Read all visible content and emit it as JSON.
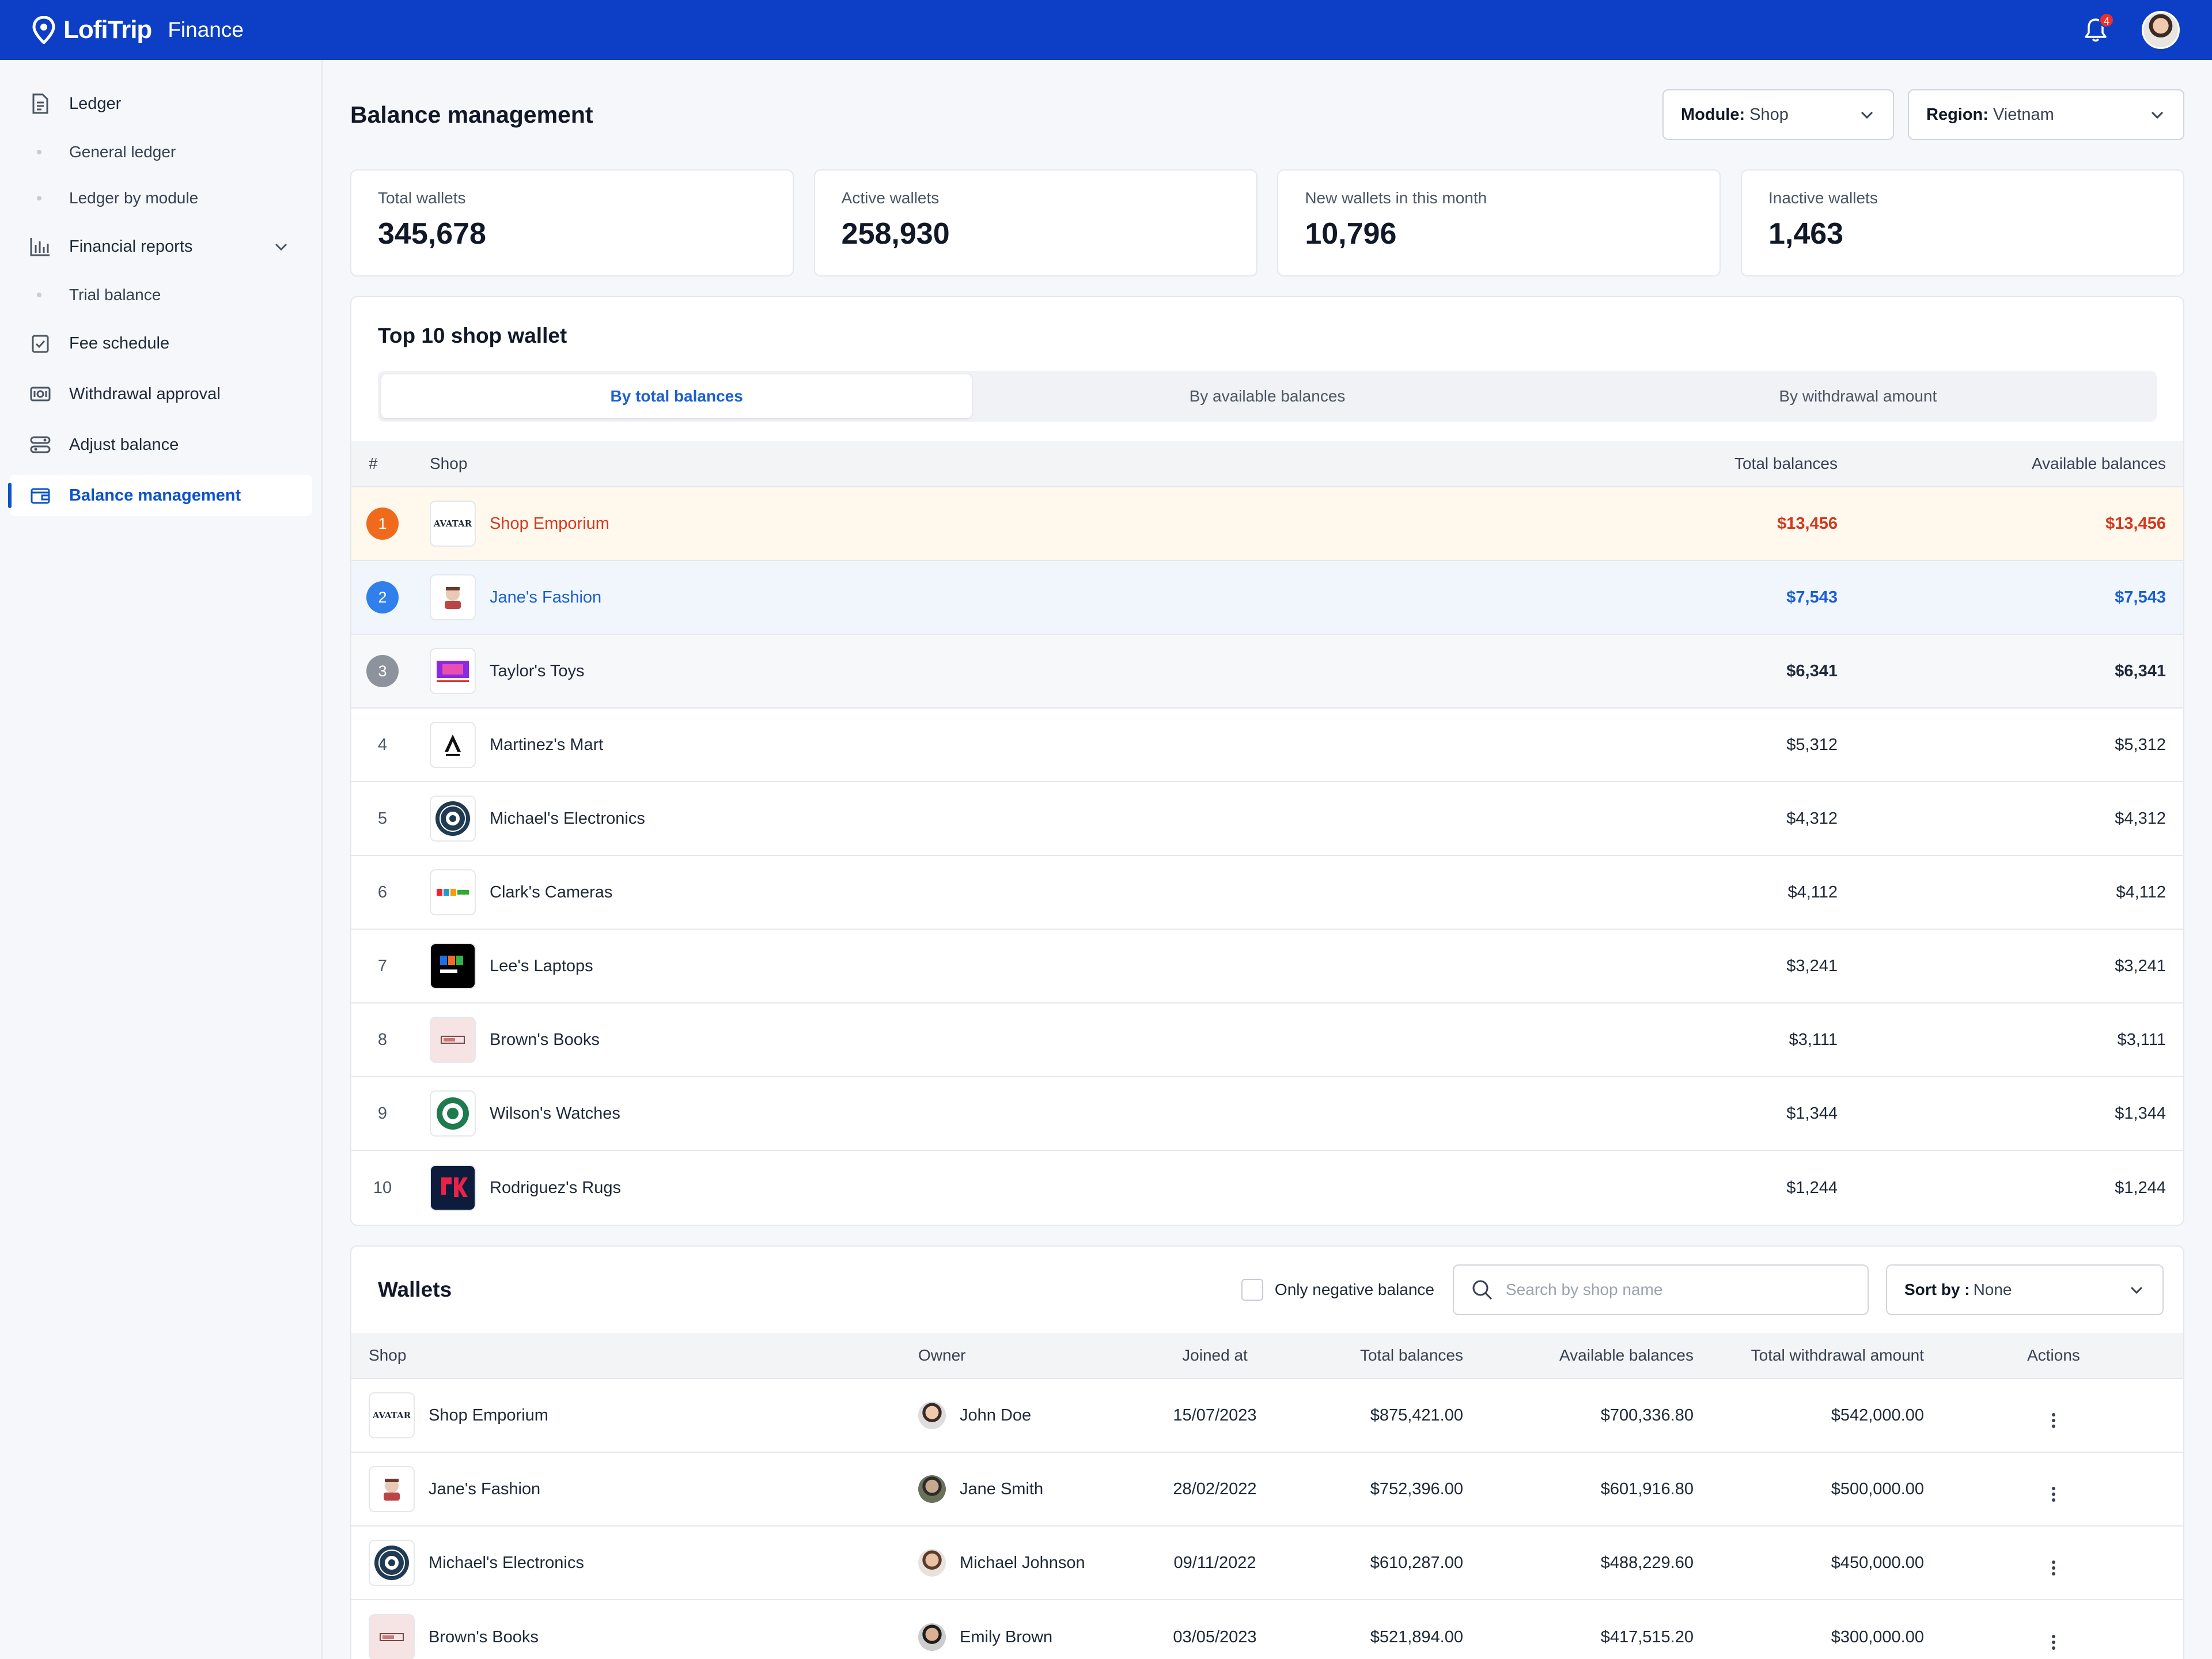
{
  "app": {
    "name": "LofiTrip",
    "section": "Finance",
    "notification_count": "4"
  },
  "sidebar": {
    "ledger": "Ledger",
    "general_ledger": "General ledger",
    "ledger_by_module": "Ledger by module",
    "financial_reports": "Financial reports",
    "trial_balance": "Trial balance",
    "fee_schedule": "Fee schedule",
    "withdrawal_approval": "Withdrawal approval",
    "adjust_balance": "Adjust balance",
    "balance_management": "Balance management"
  },
  "page": {
    "title": "Balance management",
    "module_label": "Module:",
    "module_value": "Shop",
    "region_label": "Region:",
    "region_value": "Vietnam"
  },
  "stats": [
    {
      "label": "Total wallets",
      "value": "345,678"
    },
    {
      "label": "Active wallets",
      "value": "258,930"
    },
    {
      "label": "New wallets in this month",
      "value": "10,796"
    },
    {
      "label": "Inactive wallets",
      "value": "1,463"
    }
  ],
  "top10": {
    "title": "Top 10 shop wallet",
    "tabs": [
      "By total balances",
      "By available balances",
      "By withdrawal amount"
    ],
    "columns": {
      "rank": "#",
      "shop": "Shop",
      "total": "Total balances",
      "available": "Available balances"
    },
    "rows": [
      {
        "rank": "1",
        "shop": "Shop Emporium",
        "logo": "AVATAR",
        "total": "$13,456",
        "available": "$13,456"
      },
      {
        "rank": "2",
        "shop": "Jane's Fashion",
        "logo": "",
        "total": "$7,543",
        "available": "$7,543"
      },
      {
        "rank": "3",
        "shop": "Taylor's Toys",
        "logo": "",
        "total": "$6,341",
        "available": "$6,341"
      },
      {
        "rank": "4",
        "shop": "Martinez's Mart",
        "logo": "",
        "total": "$5,312",
        "available": "$5,312"
      },
      {
        "rank": "5",
        "shop": "Michael's Electronics",
        "logo": "",
        "total": "$4,312",
        "available": "$4,312"
      },
      {
        "rank": "6",
        "shop": "Clark's Cameras",
        "logo": "",
        "total": "$4,112",
        "available": "$4,112"
      },
      {
        "rank": "7",
        "shop": "Lee's Laptops",
        "logo": "",
        "total": "$3,241",
        "available": "$3,241"
      },
      {
        "rank": "8",
        "shop": "Brown's Books",
        "logo": "",
        "total": "$3,111",
        "available": "$3,111"
      },
      {
        "rank": "9",
        "shop": "Wilson's Watches",
        "logo": "",
        "total": "$1,344",
        "available": "$1,344"
      },
      {
        "rank": "10",
        "shop": "Rodriguez's Rugs",
        "logo": "",
        "total": "$1,244",
        "available": "$1,244"
      }
    ]
  },
  "wallets": {
    "title": "Wallets",
    "negative_label": "Only negative balance",
    "search_placeholder": "Search by shop name",
    "sort_label": "Sort by :",
    "sort_value": "None",
    "columns": {
      "shop": "Shop",
      "owner": "Owner",
      "joined": "Joined at",
      "total": "Total balances",
      "available": "Available balances",
      "withdrawal": "Total withdrawal amount",
      "actions": "Actions"
    },
    "rows": [
      {
        "shop": "Shop Emporium",
        "logo": "AVATAR",
        "owner": "John Doe",
        "joined": "15/07/2023",
        "total": "$875,421.00",
        "available": "$700,336.80",
        "withdrawal": "$542,000.00"
      },
      {
        "shop": "Jane's Fashion",
        "logo": "",
        "owner": "Jane Smith",
        "joined": "28/02/2022",
        "total": "$752,396.00",
        "available": "$601,916.80",
        "withdrawal": "$500,000.00"
      },
      {
        "shop": "Michael's Electronics",
        "logo": "",
        "owner": "Michael Johnson",
        "joined": "09/11/2022",
        "total": "$610,287.00",
        "available": "$488,229.60",
        "withdrawal": "$450,000.00"
      },
      {
        "shop": "Brown's Books",
        "logo": "",
        "owner": "Emily Brown",
        "joined": "03/05/2023",
        "total": "$521,894.00",
        "available": "$417,515.20",
        "withdrawal": "$300,000.00"
      }
    ]
  },
  "colors": {
    "brand": "#0c3fc6",
    "accent": "#1c5fd4",
    "rank1": "#f06a1d",
    "rank2": "#2f80ed",
    "rank3": "#8d939c"
  }
}
